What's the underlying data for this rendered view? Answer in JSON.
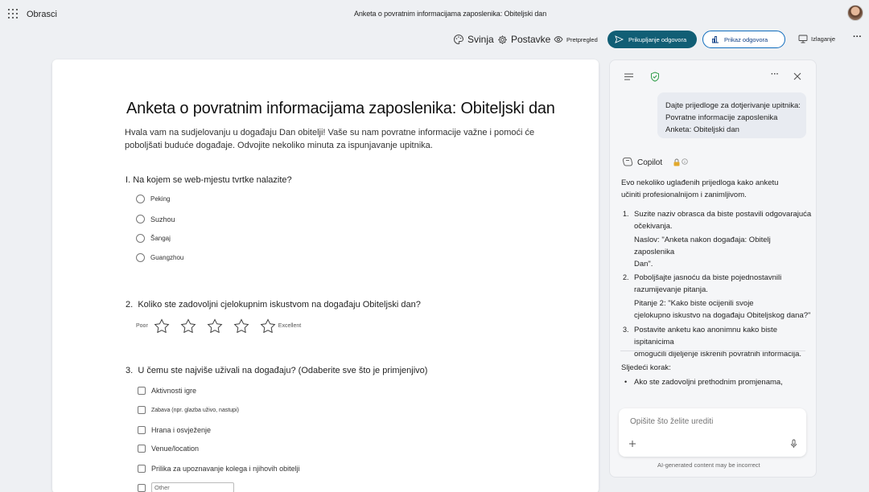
{
  "app": {
    "name": "Obrasci",
    "document_title": "Anketa o povratnim informacijama zaposlenika: Obiteljski dan"
  },
  "toolbar": {
    "theme_label": "Svinja",
    "settings_label": "Postavke",
    "preview_label": "Pretpregled",
    "collect_label": "Prikupljanje odgovora",
    "view_responses_label": "Prikaz odgovora",
    "present_label": "Izlaganje",
    "more_label": "···"
  },
  "form": {
    "title": "Anketa o povratnim informacijama zaposlenika: Obiteljski dan",
    "description": "Hvala vam na sudjelovanju u događaju Dan obitelji! Vaše su nam povratne informacije važne i pomoći će poboljšati buduće događaje. Odvojite nekoliko minuta za ispunjavanje upitnika.",
    "questions": [
      {
        "number": "I.",
        "text": "Na kojem se web-mjestu tvrtke nalazite?",
        "options": [
          "Peking",
          "Suzhou",
          "Šangaj",
          "Guangzhou"
        ]
      },
      {
        "number": "2.",
        "text": "Koliko ste zadovoljni cjelokupnim iskustvom na događaju Obiteljski dan?",
        "rating_low": "Poor",
        "rating_high": "Excellent",
        "rating_max": 5
      },
      {
        "number": "3.",
        "text": "U čemu ste najviše uživali na događaju? (Odaberite sve što je primjenjivo)",
        "options": [
          "Aktivnosti igre",
          "Zabava (npr. glazba uživo, nastupi)",
          "Hrana i osvježenje",
          "Venue/location",
          "Prilika za upoznavanje kolega i njihovih obitelji"
        ],
        "other_placeholder": "Other"
      }
    ]
  },
  "copilot": {
    "user_message": [
      "Dajte prijedloge za dotjerivanje upitnika:",
      "Povratne informacije zaposlenika",
      "Anketa: Obiteljski dan"
    ],
    "name": "Copilot",
    "intro": [
      "Evo nekoliko uglađenih prijedloga kako anketu",
      "učiniti profesionalnijom i zanimljivom."
    ],
    "suggestions": [
      {
        "number": "1.",
        "lines": [
          "Suzite naziv obrasca da biste postavili odgovarajuća",
          "očekivanja."
        ],
        "detail": [
          "Naslov: \"Anketa nakon događaja: Obitelj zaposlenika",
          "Dan\"."
        ]
      },
      {
        "number": "2.",
        "lines": [
          "Poboljšajte jasnoću da biste pojednostavnili",
          "razumijevanje pitanja."
        ],
        "detail": [
          "Pitanje 2: \"Kako biste ocijenili svoje",
          "cjelokupno iskustvo na događaju Obiteljskog dana?\""
        ]
      },
      {
        "number": "3.",
        "lines": [
          "Postavite anketu kao anonimnu kako biste ispitanicima",
          "omogućili dijeljenje iskrenih povratnih informacija."
        ]
      }
    ],
    "next_step_label": "Sljedeći korak:",
    "next_step_item": "Ako ste zadovoljni prethodnim promjenama,",
    "input_placeholder": "Opišite što želite urediti",
    "disclaimer": "AI-generated content may be incorrect"
  },
  "colors": {
    "primary_button": "#115e75",
    "outline_button_border": "#0f6cbd",
    "shield_icon": "#2e9d47"
  }
}
